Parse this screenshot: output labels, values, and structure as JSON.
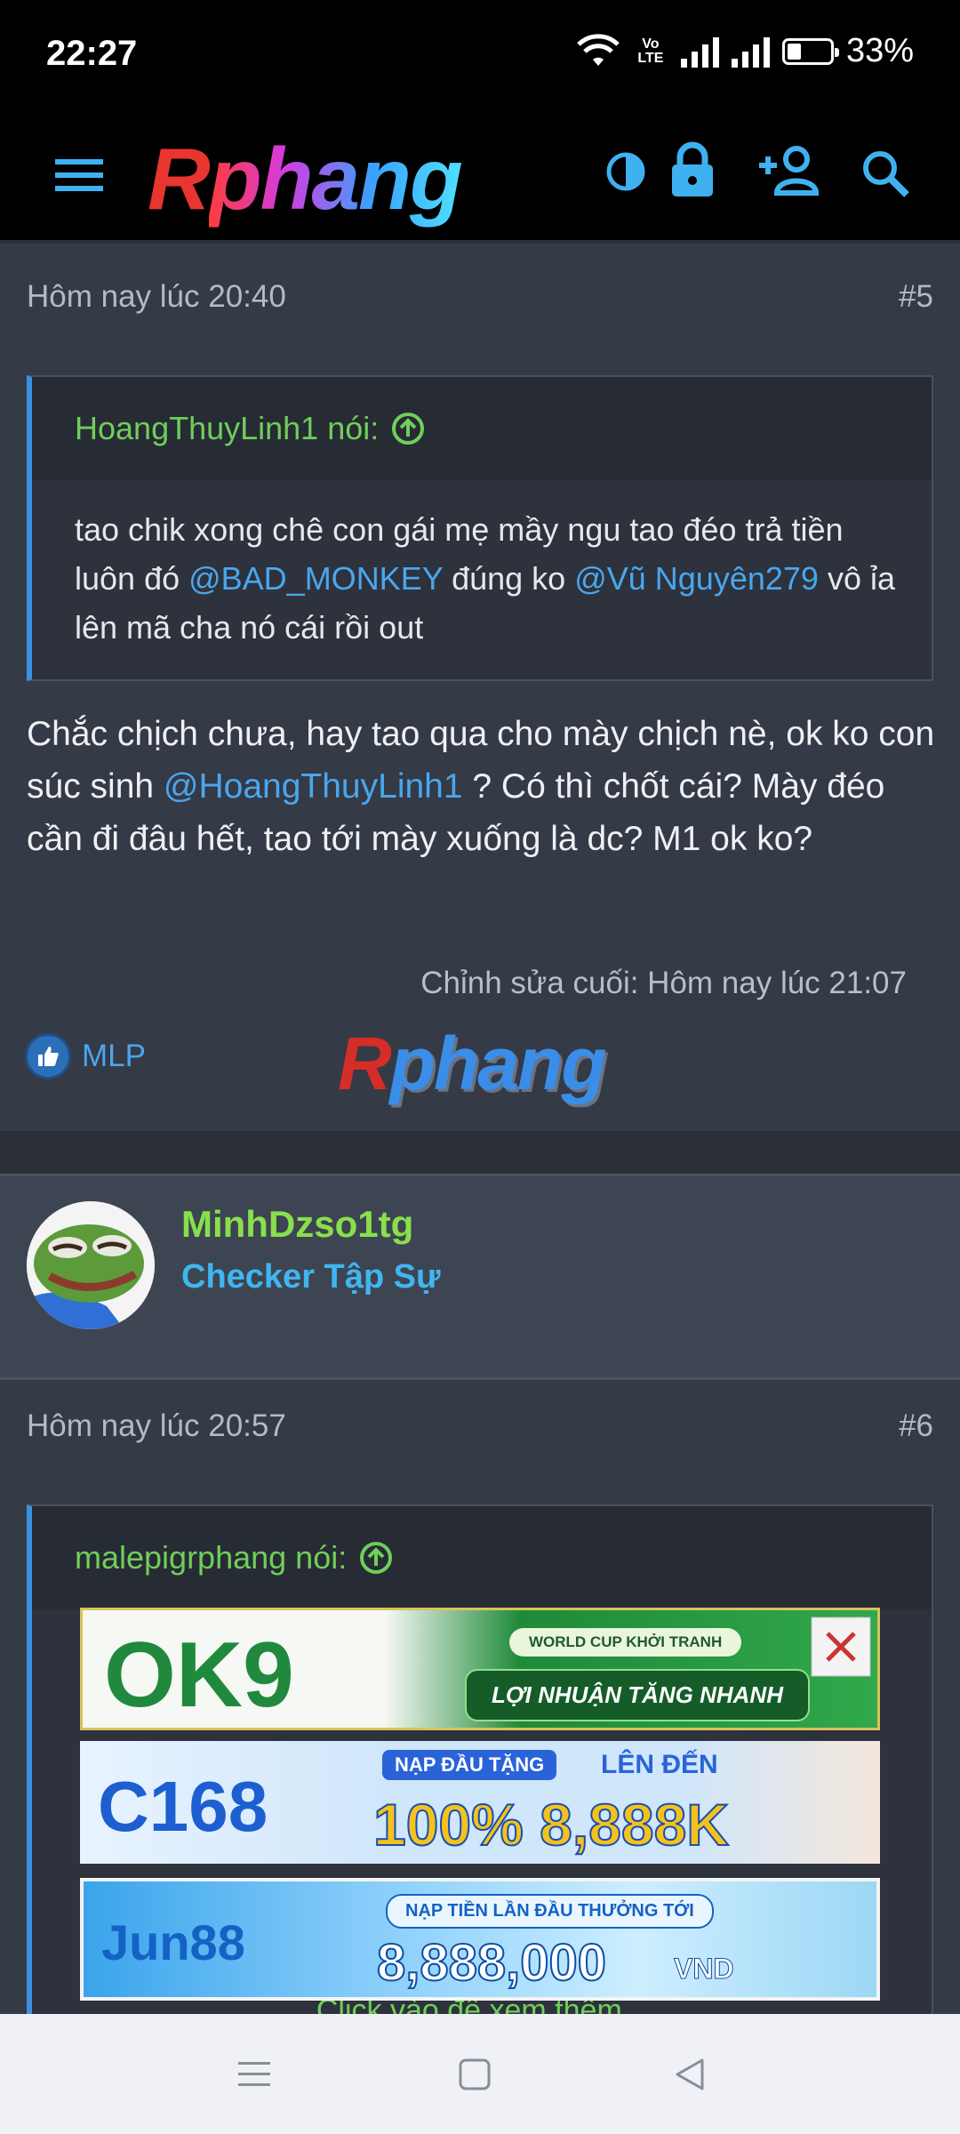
{
  "status_bar": {
    "time": "22:27",
    "network": "Vo LTE",
    "battery": "33%",
    "battery_level": 0.33
  },
  "app_bar": {
    "logo_first": "R",
    "logo_rest": "phang",
    "icons": [
      "menu-icon",
      "theme-toggle-icon",
      "lock-icon",
      "add-user-icon",
      "search-icon"
    ]
  },
  "post5": {
    "timestamp": "Hôm nay lúc 20:40",
    "number": "#5",
    "quote_author": "HoangThuyLinh1 nói:",
    "quote_parts": [
      "tao chik xong chê con gái mẹ mầy ngu tao đéo trả tiền luôn đó ",
      "@BAD_MONKEY",
      " đúng ko ",
      "@Vũ Nguyên279",
      " vô ỉa lên mã cha nó cái rồi out"
    ],
    "message_parts": [
      "Chắc chịch chưa, hay tao qua cho mày chịch nè, ok ko con súc sinh ",
      "@HoangThuyLinh1",
      " ? Có thì chốt cái? Mày đéo cần đi đâu hết, tao tới mày xuống là dc? M1 ok ko?"
    ],
    "edited": "Chỉnh sửa cuối: Hôm nay lúc 21:07",
    "reaction_user": "MLP",
    "signature_first": "R",
    "signature_rest": "phang"
  },
  "user6": {
    "name": "MinhDzso1tg",
    "title": "Checker Tập Sự"
  },
  "post6": {
    "timestamp": "Hôm nay lúc 20:57",
    "number": "#6",
    "quote_author": "malepigrphang nói:",
    "expand": "Click vào để xem thêm..."
  },
  "ads": [
    {
      "brand": "OK9",
      "tagline": "WORLD CUP KHỞI TRANH",
      "headline": "LỢI NHUẬN TĂNG NHANH"
    },
    {
      "brand": "C168",
      "tagline": "NẠP ĐẦU TẶNG",
      "sub": "LÊN ĐẾN",
      "headline": "100% 8,888K"
    },
    {
      "brand": "Jun88",
      "tagline": "NẠP TIỀN LẦN ĐẦU THƯỞNG TỚI",
      "headline": "8,888,000",
      "unit": "VND"
    }
  ],
  "nav": {
    "icons": [
      "recents-icon",
      "home-icon",
      "back-icon"
    ]
  },
  "colors": {
    "accent": "#3a91e0",
    "username": "#88e04a",
    "mention": "#4aa6ee",
    "quote_author": "#6fcf5a"
  }
}
